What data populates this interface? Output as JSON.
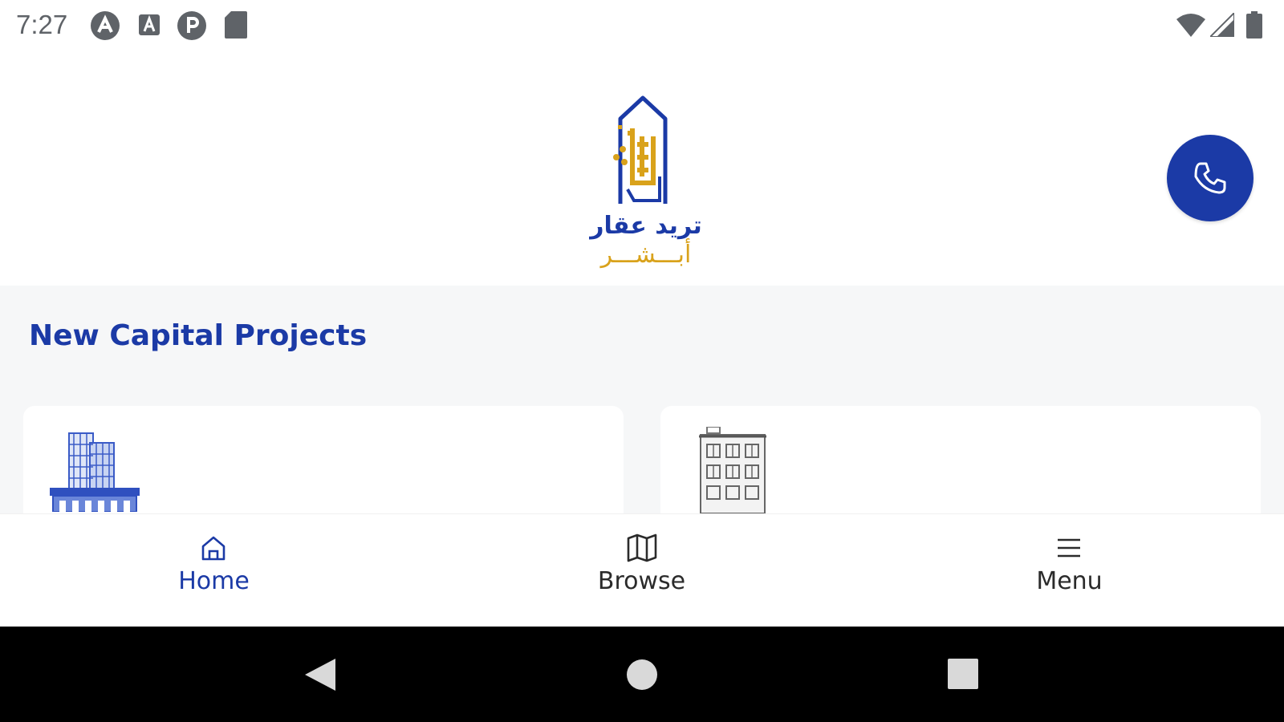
{
  "status_bar": {
    "time": "7:27",
    "left_icons": [
      "app-notification-icon",
      "a-box-icon",
      "p-circle-icon",
      "sd-card-icon"
    ],
    "right_icons": [
      "wifi-icon",
      "signal-icon",
      "battery-icon"
    ]
  },
  "header": {
    "logo_line1": "تريد عقار",
    "logo_line2": "أبـــشـــر",
    "call_icon": "phone-icon"
  },
  "section": {
    "title": "New Capital Projects"
  },
  "cards": [
    {
      "icon": "tower-building-icon"
    },
    {
      "icon": "apartment-building-icon"
    }
  ],
  "bottom_nav": {
    "items": [
      {
        "label": "Home",
        "icon": "home-icon",
        "active": true
      },
      {
        "label": "Browse",
        "icon": "map-icon",
        "active": false
      },
      {
        "label": "Menu",
        "icon": "menu-icon",
        "active": false
      }
    ]
  },
  "system_nav": {
    "buttons": [
      "back-icon",
      "home-circle-icon",
      "recents-icon"
    ]
  },
  "colors": {
    "brand_blue": "#1b3aa6",
    "brand_gold": "#d9a21b",
    "background": "#f6f7f8"
  }
}
